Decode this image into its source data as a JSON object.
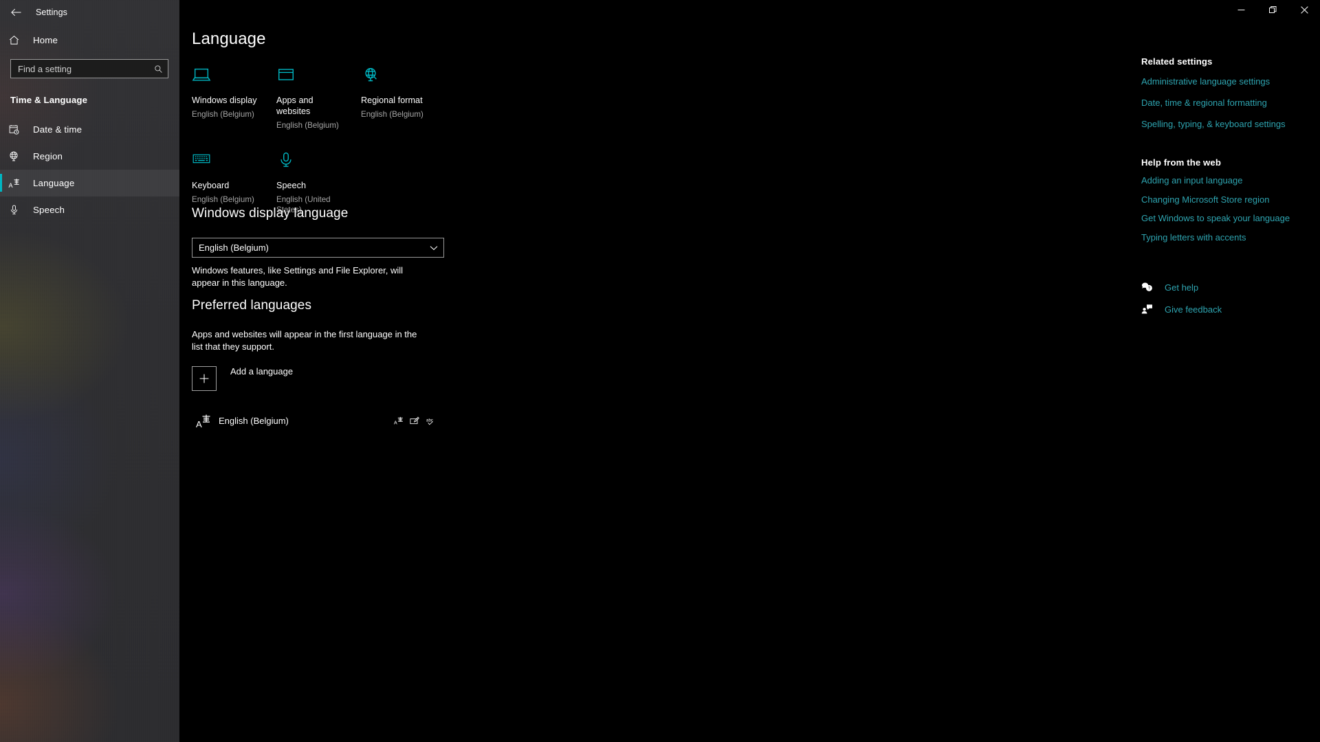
{
  "window": {
    "app_title": "Settings",
    "back_icon": "arrow-left-icon",
    "controls": {
      "minimize": "minimize-icon",
      "maximize": "restore-icon",
      "close": "close-icon"
    }
  },
  "sidebar": {
    "home": {
      "label": "Home",
      "icon": "home-icon"
    },
    "search": {
      "placeholder": "Find a setting",
      "value": "",
      "icon": "search-icon"
    },
    "group_header": "Time & Language",
    "items": [
      {
        "label": "Date & time",
        "icon": "calendar-clock-icon",
        "selected": false
      },
      {
        "label": "Region",
        "icon": "globe-icon",
        "selected": false
      },
      {
        "label": "Language",
        "icon": "language-icon",
        "selected": true
      },
      {
        "label": "Speech",
        "icon": "microphone-icon",
        "selected": false
      }
    ],
    "accent_color": "#00b7c3"
  },
  "main": {
    "page_title": "Language",
    "tiles": [
      {
        "name": "Windows display",
        "value": "English (Belgium)",
        "icon": "laptop-icon"
      },
      {
        "name": "Apps and websites",
        "value": "English (Belgium)",
        "icon": "window-icon"
      },
      {
        "name": "Regional format",
        "value": "English (Belgium)",
        "icon": "globe-stand-icon"
      },
      {
        "name": "Keyboard",
        "value": "English (Belgium)",
        "icon": "keyboard-icon"
      },
      {
        "name": "Speech",
        "value": "English (United States)",
        "icon": "microphone-icon"
      }
    ],
    "display_language": {
      "title": "Windows display language",
      "selected": "English (Belgium)",
      "description": "Windows features, like Settings and File Explorer, will appear in this language.",
      "chevron": "chevron-down-icon"
    },
    "preferred_languages": {
      "title": "Preferred languages",
      "description": "Apps and websites will appear in the first language in the list that they support.",
      "add_label": "Add a language",
      "add_icon": "plus-icon",
      "rows": [
        {
          "name": "English (Belgium)",
          "icon": "language-icon",
          "badges": [
            "input-method-icon",
            "handwriting-icon",
            "spellcheck-icon"
          ]
        }
      ]
    }
  },
  "rail": {
    "related_heading": "Related settings",
    "related_links": [
      "Administrative language settings",
      "Date, time & regional formatting",
      "Spelling, typing, & keyboard settings"
    ],
    "help_heading": "Help from the web",
    "help_links": [
      "Adding an input language",
      "Changing Microsoft Store region",
      "Get Windows to speak your language",
      "Typing letters with accents"
    ],
    "actions": [
      {
        "label": "Get help",
        "icon": "help-bubble-icon"
      },
      {
        "label": "Give feedback",
        "icon": "feedback-icon"
      }
    ],
    "link_color": "#2ea4b0"
  }
}
